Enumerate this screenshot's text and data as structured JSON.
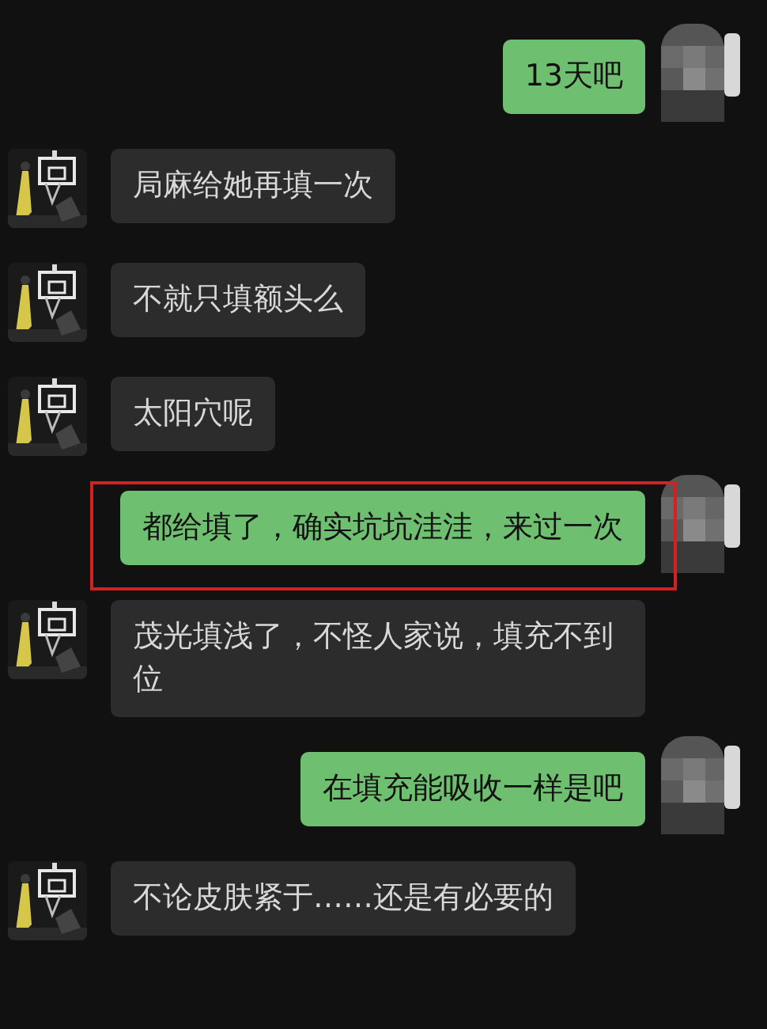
{
  "messages": [
    {
      "kind": "sent",
      "text": "13天吧",
      "highlighted": false
    },
    {
      "kind": "received",
      "text": "局麻给她再填一次",
      "highlighted": false
    },
    {
      "kind": "received",
      "text": "不就只填额头么",
      "highlighted": false
    },
    {
      "kind": "received",
      "text": "太阳穴呢",
      "highlighted": false
    },
    {
      "kind": "sent",
      "text": "都给填了，确实坑坑洼洼，来过一次",
      "highlighted": true
    },
    {
      "kind": "received",
      "text": "茂光填浅了，不怪人家说，填充不到位",
      "highlighted": false
    },
    {
      "kind": "sent",
      "text": "在填充能吸收一样是吧",
      "highlighted": false
    },
    {
      "kind": "received",
      "text": "不论皮肤紧于……还是有必要的",
      "highlighted": false
    }
  ]
}
